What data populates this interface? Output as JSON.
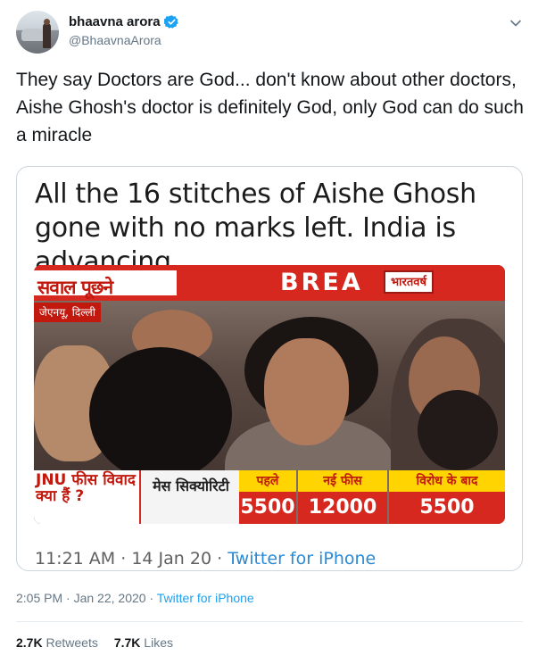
{
  "author": {
    "display_name": "bhaavna arora",
    "handle": "@BhaavnaArora"
  },
  "tweet": {
    "text": "They say Doctors are God... don't know about other doctors, Aishe Ghosh's doctor is definitely God, only God can do such a miracle",
    "time": "2:05 PM",
    "date": "Jan 22, 2020",
    "source": "Twitter for iPhone"
  },
  "quoted": {
    "headline": "All the 16 stitches of Aishe Ghosh gone with no marks left. India is advancing",
    "time": "11:21 AM",
    "date": "14 Jan 20",
    "source": "Twitter for iPhone",
    "broadcast": {
      "top_label": "सवाल पूछने",
      "breaking": "BREA",
      "channel": "भारतवर्ष",
      "location": "जेएनयू, दिल्ली",
      "question": "JNU फीस विवाद क्या हैं ?",
      "item": "मेस सिक्योरिटी",
      "columns": [
        {
          "header": "पहले",
          "value": "5500"
        },
        {
          "header": "नई फीस",
          "value": "12000"
        },
        {
          "header": "विरोध के बाद",
          "value": "5500"
        }
      ]
    }
  },
  "stats": {
    "retweets_count": "2.7K",
    "retweets_label": "Retweets",
    "likes_count": "7.7K",
    "likes_label": "Likes"
  },
  "colors": {
    "verified": "#1da1f2",
    "link": "#1da1f2",
    "channel_red": "#d6281f",
    "channel_yellow": "#ffd400"
  }
}
